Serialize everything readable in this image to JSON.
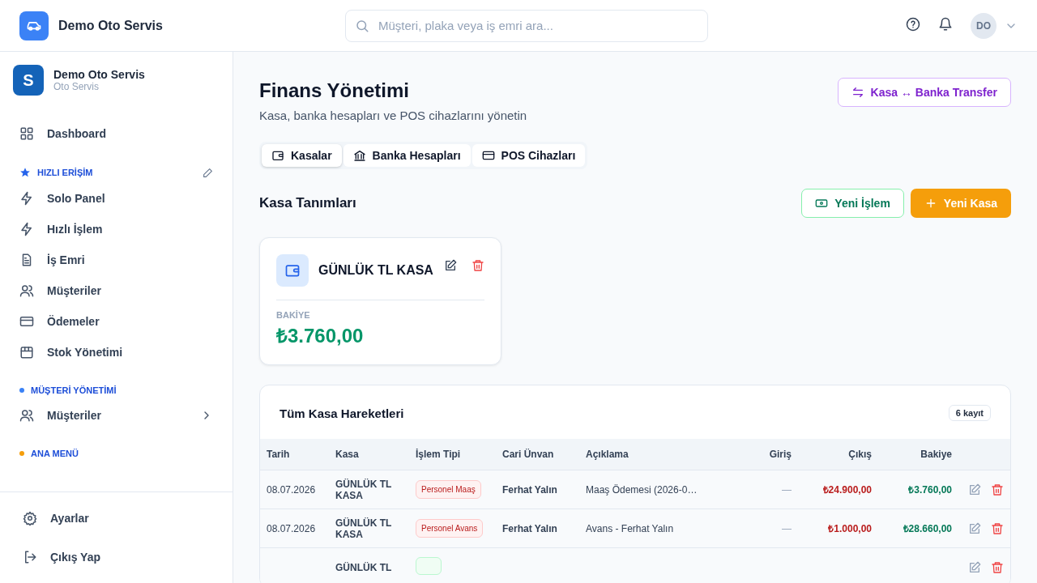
{
  "topbar": {
    "brand": "Demo Oto Servis",
    "search": {
      "placeholder": "Müşteri, plaka veya iş emri ara..."
    },
    "avatar": "DO"
  },
  "sidebar": {
    "org": {
      "initial": "S",
      "name": "Demo Oto Servis",
      "subtitle": "Oto Servis"
    },
    "items": [
      {
        "label": "Dashboard"
      }
    ],
    "sections": [
      {
        "title": "HIZLI ERİŞİM",
        "kind": "star",
        "color": "#2563eb",
        "editable": true,
        "items": [
          {
            "label": "Solo Panel"
          },
          {
            "label": "Hızlı İşlem"
          },
          {
            "label": "İş Emri"
          },
          {
            "label": "Müşteriler"
          },
          {
            "label": "Ödemeler"
          },
          {
            "label": "Stok Yönetimi"
          }
        ]
      },
      {
        "title": "MÜŞTERİ YÖNETİMİ",
        "kind": "dot",
        "color": "#3b82f6",
        "editable": false,
        "items": [
          {
            "label": "Müşteriler",
            "expanded": false
          }
        ]
      },
      {
        "title": "ANA MENÜ",
        "kind": "dot",
        "color": "#f59e0b",
        "editable": false
      }
    ],
    "footer": [
      {
        "label": "Ayarlar"
      },
      {
        "label": "Çıkış Yap"
      }
    ]
  },
  "page": {
    "title": "Finans Yönetimi",
    "subtitle": "Kasa, banka hesapları ve POS cihazlarını yönetin",
    "transfer_button": "Kasa ↔ Banka Transfer"
  },
  "tabs": [
    {
      "label": "Kasalar",
      "selected": true
    },
    {
      "label": "Banka Hesapları",
      "selected": false
    },
    {
      "label": "POS Cihazları",
      "selected": false
    }
  ],
  "section": {
    "title": "Kasa Tanımları",
    "buttons": [
      {
        "label": "Yeni İşlem",
        "kind": "outline"
      },
      {
        "label": "Yeni Kasa",
        "kind": "primary"
      }
    ]
  },
  "cash_boxes": [
    {
      "name": "GÜNLÜK TL KASA",
      "balance_label": "BAKİYE",
      "balance": "₺3.760,00"
    }
  ],
  "table": {
    "title": "Tüm Kasa Hareketleri",
    "count": "6 kayıt",
    "columns": [
      "Tarih",
      "Kasa",
      "İşlem Tipi",
      "Cari Ünvan",
      "Açıklama",
      "Giriş",
      "Çıkış",
      "Bakiye"
    ],
    "rows": [
      {
        "date": "08.07.2026",
        "box": "GÜNLÜK TL KASA",
        "type": "Personel Maaş",
        "kind": "expense",
        "party": "Ferhat Yalın",
        "description": "Maaş Ödemesi (2026-0…",
        "in": "—",
        "out": "₺24.900,00",
        "balance": "₺3.760,00"
      },
      {
        "date": "08.07.2026",
        "box": "GÜNLÜK TL KASA",
        "type": "Personel Avans",
        "kind": "expense",
        "party": "Ferhat Yalın",
        "description": "Avans - Ferhat Yalın",
        "in": "—",
        "out": "₺1.000,00",
        "balance": "₺28.660,00"
      },
      {
        "box": "GÜNLÜK TL",
        "kind": "income"
      }
    ]
  }
}
